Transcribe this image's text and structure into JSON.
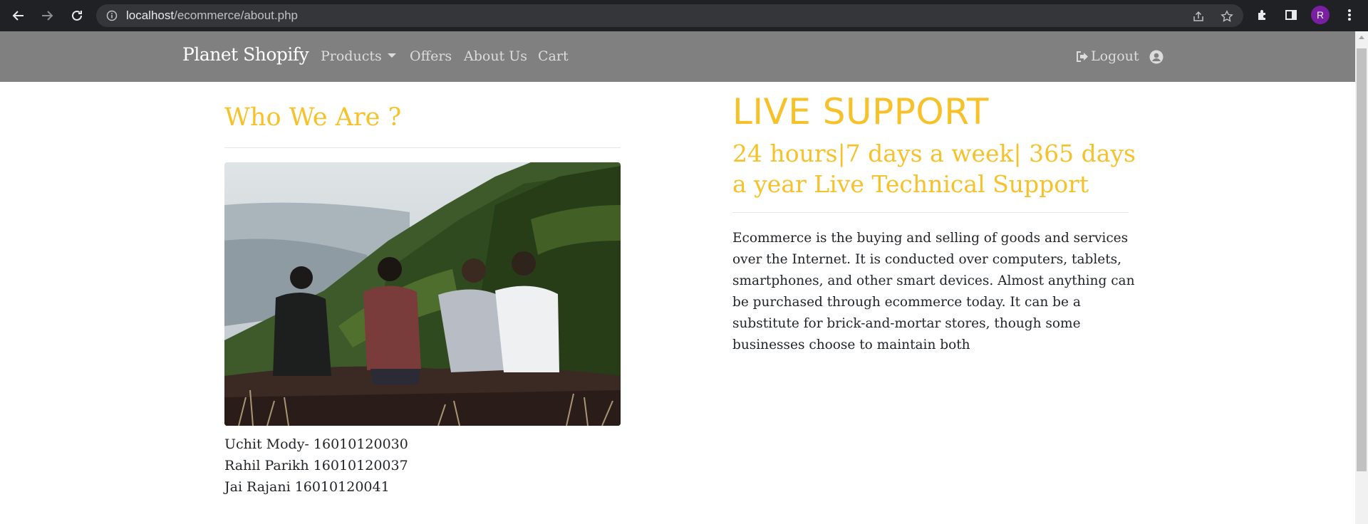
{
  "browser": {
    "url_host": "localhost",
    "url_path": "/ecommerce/about.php",
    "profile_initial": "R"
  },
  "navbar": {
    "brand": "Planet Shopify",
    "links": {
      "products": "Products",
      "offers": "Offers",
      "about": "About Us",
      "cart": "Cart"
    },
    "logout": "Logout"
  },
  "about": {
    "title": "Who We Are ?",
    "members": [
      "Uchit Mody- 16010120030",
      "Rahil Parikh 16010120037",
      "Jai Rajani 16010120041"
    ]
  },
  "support": {
    "title": "LIVE SUPPORT",
    "subtitle": "24 hours|7 days a week| 365 days a year Live Technical Support",
    "description": "Ecommerce is the buying and selling of goods and services over the Internet. It is conducted over computers, tablets, smartphones, and other smart devices. Almost anything can be purchased through ecommerce today. It can be a substitute for brick-and-mortar stores, though some businesses choose to maintain both"
  },
  "theme": {
    "accent": "#f7c12a",
    "navbar_bg": "#808080",
    "text": "#212529"
  }
}
